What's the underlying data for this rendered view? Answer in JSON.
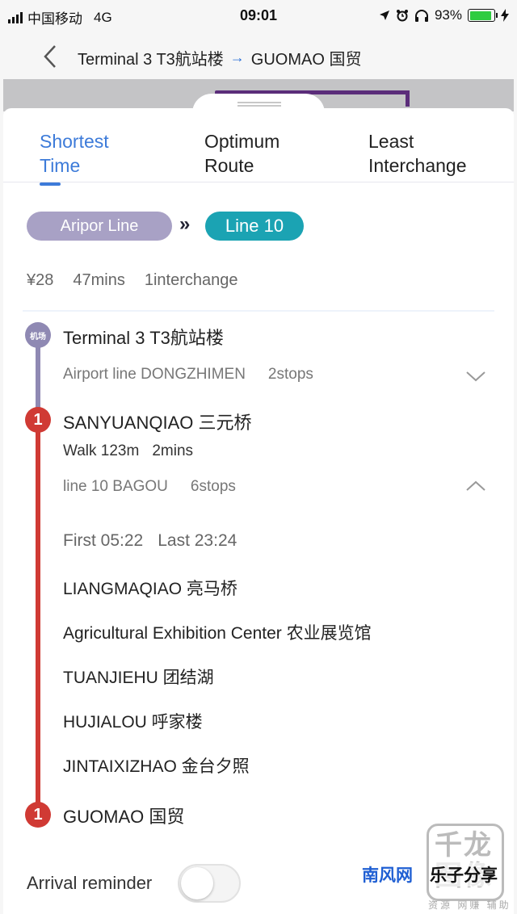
{
  "status_bar": {
    "carrier": "中国移动",
    "network": "4G",
    "time": "09:01",
    "battery": "93%"
  },
  "header": {
    "from": "Terminal 3 T3航站楼",
    "arrow": "→",
    "to": "GUOMAO 国贸"
  },
  "tabs": [
    {
      "label_line1": "Shortest",
      "label_line2": "Time",
      "active": true
    },
    {
      "label_line1": "Optimum",
      "label_line2": "Route",
      "active": false
    },
    {
      "label_line1": "Least",
      "label_line2": "Interchange",
      "active": false
    }
  ],
  "lines": {
    "first": "Aripor Line",
    "arrow": "»",
    "second": "Line 10"
  },
  "summary": {
    "price": "¥28",
    "duration": "47mins",
    "interchanges": "1interchange"
  },
  "route": {
    "start": {
      "badge": "机场",
      "name": "Terminal 3 T3航站楼",
      "segment": "Airport line DONGZHIMEN",
      "stops": "2stops"
    },
    "transfer": {
      "badge": "1",
      "name": "SANYUANQIAO 三元桥",
      "walk_distance": "Walk 123m",
      "walk_time": "2mins",
      "segment": "line 10 BAGOU",
      "stops": "6stops",
      "first": "First 05:22",
      "last": "Last 23:24"
    },
    "intermediate": [
      "LIANGMAQIAO 亮马桥",
      "Agricultural Exhibition Center 农业展览馆",
      "TUANJIEHU 团结湖",
      "HUJIALOU 呼家楼",
      "JINTAIXIZHAO 金台夕照"
    ],
    "end": {
      "badge": "1",
      "name": "GUOMAO 国贸"
    }
  },
  "reminder": {
    "label": "Arrival reminder",
    "enabled": false
  },
  "watermark": {
    "big": "千龙图像",
    "name1": "南风网",
    "name2": "乐子分享",
    "sub": "资源 网赚 辅助"
  },
  "colors": {
    "accent": "#3d7bd9",
    "airport_line": "#a8a1c5",
    "line10": "#1ba3b3",
    "line1": "#d03a34"
  }
}
